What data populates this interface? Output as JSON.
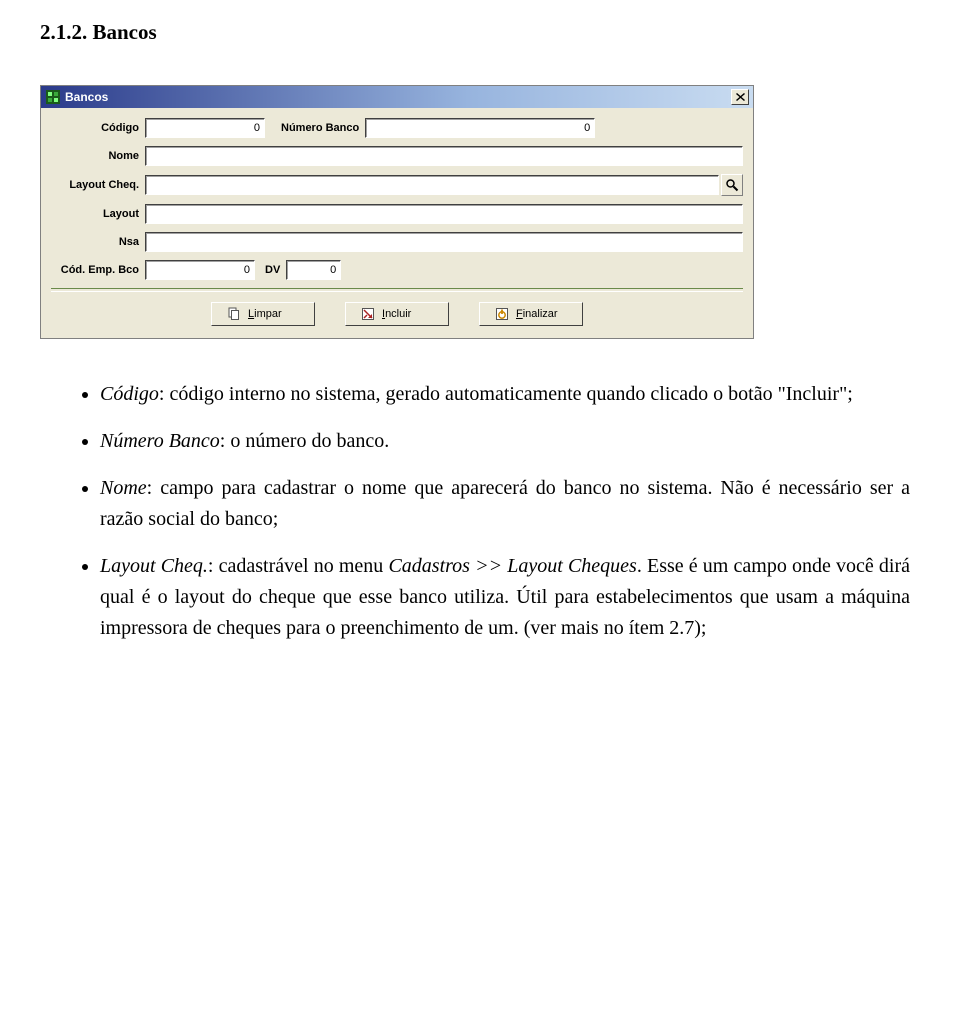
{
  "heading": "2.1.2.  Bancos",
  "window": {
    "title": "Bancos",
    "fields": {
      "codigo_label": "Código",
      "codigo_value": "0",
      "numero_banco_label": "Número Banco",
      "numero_banco_value": "0",
      "nome_label": "Nome",
      "nome_value": "",
      "layout_cheq_label": "Layout Cheq.",
      "layout_cheq_value": "",
      "layout_label": "Layout",
      "layout_value": "",
      "nsa_label": "Nsa",
      "nsa_value": "",
      "cod_emp_bco_label": "Cód. Emp. Bco",
      "cod_emp_bco_value": "0",
      "dv_label": "DV",
      "dv_value": "0"
    },
    "buttons": {
      "limpar": "Limpar",
      "incluir": "Incluir",
      "finalizar": "Finalizar"
    }
  },
  "bullets": {
    "b1_field": "Código",
    "b1_text": ": código interno no sistema, gerado automaticamente quando clicado o botão \"Incluir\";",
    "b2_field": "Número Banco",
    "b2_text": ": o número do banco.",
    "b3_field": "Nome",
    "b3_text": ": campo para cadastrar o nome que aparecerá do banco no sistema. Não é necessário ser a razão social do banco;",
    "b4_field": "Layout Cheq.",
    "b4_text_a": ": cadastrável no menu ",
    "b4_em": "Cadastros >> Layout Cheques",
    "b4_text_b": ". Esse é um campo onde você dirá qual é o layout do cheque que esse banco utiliza. Útil para estabelecimentos que usam a máquina impressora de cheques para o preenchimento de um. (ver mais no ítem 2.7);"
  }
}
